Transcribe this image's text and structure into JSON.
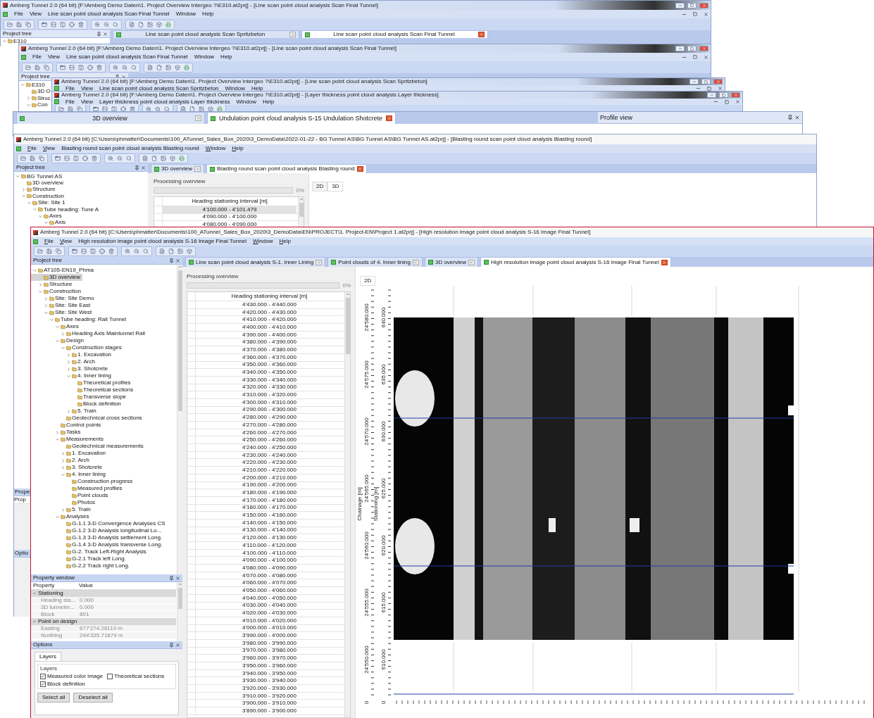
{
  "windows": [
    {
      "kind": "compact",
      "title": "Amberg Tunnel 2.0 (64 bit) [F:\\Amberg Demo Daten\\1. Project Overview Intergeo ?\\E310.at2prj] - [Line scan point cloud analysis Scan Final Tunnel]",
      "menu": [
        {
          "label": "File"
        },
        {
          "label": "View"
        },
        {
          "label": "Line scan point cloud analysis Scan Final Tunnel"
        },
        {
          "label": "Window"
        },
        {
          "label": "Help"
        }
      ],
      "tree_title": "Project tree",
      "tree": [
        {
          "label": "E310",
          "expanded": true,
          "selected": false
        }
      ],
      "tabs": [
        {
          "label": "Line scan point cloud analysis Scan Spritzbeton",
          "selected": false
        },
        {
          "label": "Line scan point cloud analysis Scan Final Tunnel",
          "selected": true
        }
      ]
    },
    {
      "kind": "compact",
      "title": "Amberg Tunnel 2.0 (64 bit) [F:\\Amberg Demo Daten\\1. Project Overview Intergeo ?\\E310.at2prj] - [Line scan point cloud analysis Scan Final Tunnel]",
      "menu": [
        {
          "label": "File"
        },
        {
          "label": "View"
        },
        {
          "label": "Line scan point cloud analysis Scan Final Tunnel"
        },
        {
          "label": "Window"
        },
        {
          "label": "Help"
        }
      ],
      "tree_title": "Project tree",
      "tree": [
        {
          "label": "E310",
          "expanded": true,
          "selected": false,
          "children": [
            {
              "label": "3D O",
              "selected": false
            },
            {
              "label": "Struc",
              "expanded": false,
              "selected": false
            },
            {
              "label": "Con",
              "expanded": true,
              "selected": false
            }
          ]
        }
      ]
    },
    {
      "kind": "compact",
      "title": "Amberg Tunnel 2.0 (64 bit) [F:\\Amberg Demo Daten\\1. Project Overview Intergeo ?\\E310.at2prj] - [Line scan point cloud analysis Scan Spritzbeton]",
      "menu": [
        {
          "label": "File"
        },
        {
          "label": "View"
        },
        {
          "label": "Line scan point cloud analysis Scan Spritzbeton"
        },
        {
          "label": "Window"
        },
        {
          "label": "Help"
        }
      ]
    },
    {
      "kind": "compact",
      "title": "Amberg Tunnel 2.0 (64 bit) [F:\\Amberg Demo Daten\\1. Project Overview Intergeo ?\\E310.at2prj] - [Layer thickness point cloud analysis Layer thickness]",
      "menu": [
        {
          "label": "File"
        },
        {
          "label": "View"
        },
        {
          "label": "Layer thickness point cloud analysis Layer thickness"
        },
        {
          "label": "Window"
        },
        {
          "label": "Help"
        }
      ]
    },
    {
      "kind": "fragment",
      "tabs": [
        {
          "label": "3D overview",
          "selected": false
        },
        {
          "label": "Undulation point cloud analysis S-15 Undulation Shotcrete",
          "selected": true
        }
      ],
      "panel_title": "Profile view"
    },
    {
      "kind": "blast",
      "title": "Amberg Tunnel 2.0 (64 bit) [C:\\Users\\phmatter\\Documents\\100_ATunnel_Sales_Box_2020\\3_DemoData\\2022-01-22 - BG Tunnel AS\\BG Tunnel AS\\BG Tunnel AS.at2prj] - [Blasting round scan point cloud analysis Blasting round]",
      "menu": [
        {
          "label": "File",
          "kind": "command"
        },
        {
          "label": "View",
          "kind": "command"
        },
        {
          "label": "Blasting round scan point cloud analysis Blasting round",
          "kind": "document"
        },
        {
          "label": "Window",
          "kind": "command"
        },
        {
          "label": "Help",
          "kind": "command"
        }
      ],
      "tree_title": "Project tree",
      "tree": [
        {
          "label": "BG Tunnel AS",
          "expanded": true,
          "selected": false,
          "children": [
            {
              "label": "3D overview",
              "selected": false
            },
            {
              "label": "Structure",
              "expanded": false,
              "selected": false
            },
            {
              "label": "Construction",
              "expanded": true,
              "selected": false,
              "children": [
                {
                  "label": "Site: Site 1",
                  "expanded": true,
                  "selected": false,
                  "children": [
                    {
                      "label": "Tube heading: Tune A",
                      "expanded": true,
                      "selected": false,
                      "children": [
                        {
                          "label": "Axes",
                          "expanded": true,
                          "selected": false,
                          "children": [
                            {
                              "label": "Axis",
                              "expanded": true,
                              "selected": false
                            }
                          ]
                        }
                      ]
                    }
                  ]
                }
              ]
            }
          ]
        }
      ],
      "property_stub": "Prope",
      "property_column_stub": "Prop",
      "options_stub": "Optio",
      "tabs": [
        {
          "label": "3D overview",
          "selected": false
        },
        {
          "label": "Blasting round scan point cloud analysis Blasting round",
          "selected": true
        }
      ],
      "progress": {
        "label": "Processing overview",
        "level": 0,
        "reading": "0%"
      },
      "table_header": "Heading stationing interval [m]",
      "rows": [
        {
          "range": "4'100.000 - 4'101.479",
          "selected": true
        },
        {
          "range": "4'090.000 - 4'100.000",
          "selected": false
        },
        {
          "range": "4'080.000 - 4'090.000",
          "selected": false
        }
      ],
      "view_tabs": [
        {
          "label": "2D",
          "selected": false
        },
        {
          "label": "3D",
          "selected": true
        }
      ]
    },
    {
      "kind": "main",
      "title": "Amberg Tunnel 2.0 (64 bit) [C:\\Users\\phmatter\\Documents\\100_ATunnel_Sales_Box_2020\\3_DemoData\\EN\\PROJECT\\1. Project-EN\\Project 1.at2prj] - [High resolution image point cloud analysis S-16 Image Final Tunnel]",
      "menu": [
        {
          "label": "File",
          "kind": "command"
        },
        {
          "label": "View",
          "kind": "command"
        },
        {
          "label": "High resolution image point cloud analysis S-16 Image Final Tunnel",
          "kind": "document"
        },
        {
          "label": "Window",
          "kind": "command"
        },
        {
          "label": "Help",
          "kind": "command"
        }
      ],
      "tree_title": "Project tree",
      "tree": [
        {
          "label": "AT105-EN19_Phma",
          "expanded": true,
          "selected": false,
          "children": [
            {
              "label": "3D overview",
              "selected": true
            },
            {
              "label": "Structure",
              "expanded": false,
              "selected": false
            },
            {
              "label": "Construction",
              "expanded": true,
              "selected": false,
              "children": [
                {
                  "label": "Site: Site Demo",
                  "expanded": false,
                  "selected": false
                },
                {
                  "label": "Site: Site East",
                  "expanded": false,
                  "selected": false
                },
                {
                  "label": "Site: Site West",
                  "expanded": true,
                  "selected": false,
                  "children": [
                    {
                      "label": "Tube heading: Rail Tunnel",
                      "expanded": true,
                      "selected": false,
                      "children": [
                        {
                          "label": "Axes",
                          "expanded": true,
                          "selected": false,
                          "children": [
                            {
                              "label": "Heading Axis Maintunnel Rail",
                              "expanded": false,
                              "selected": false
                            }
                          ]
                        },
                        {
                          "label": "Design",
                          "expanded": true,
                          "selected": false,
                          "children": [
                            {
                              "label": "Construction stages",
                              "expanded": true,
                              "selected": false,
                              "children": [
                                {
                                  "label": "1. Excavation",
                                  "expanded": false,
                                  "selected": false
                                },
                                {
                                  "label": "2. Arch",
                                  "expanded": false,
                                  "selected": false
                                },
                                {
                                  "label": "3. Shotcrete",
                                  "expanded": false,
                                  "selected": false
                                },
                                {
                                  "label": "4. Inner lining",
                                  "expanded": true,
                                  "selected": false,
                                  "children": [
                                    {
                                      "label": "Theoretical profiles",
                                      "selected": false
                                    },
                                    {
                                      "label": "Theoretical sections",
                                      "selected": false
                                    },
                                    {
                                      "label": "Transverse slope",
                                      "selected": false
                                    },
                                    {
                                      "label": "Block definition",
                                      "selected": false
                                    }
                                  ]
                                },
                                {
                                  "label": "5. Train",
                                  "expanded": false,
                                  "selected": false
                                }
                              ]
                            },
                            {
                              "label": "Geotechnical cross sections",
                              "selected": false
                            }
                          ]
                        },
                        {
                          "label": "Control points",
                          "selected": false
                        },
                        {
                          "label": "Tasks",
                          "expanded": false,
                          "selected": false
                        },
                        {
                          "label": "Measurements",
                          "expanded": true,
                          "selected": false,
                          "children": [
                            {
                              "label": "Geotechnical measurements",
                              "selected": false
                            },
                            {
                              "label": "1. Excavation",
                              "expanded": false,
                              "selected": false
                            },
                            {
                              "label": "2. Arch",
                              "expanded": false,
                              "selected": false
                            },
                            {
                              "label": "3. Shotcrete",
                              "expanded": false,
                              "selected": false
                            },
                            {
                              "label": "4. Inner lining",
                              "expanded": true,
                              "selected": false,
                              "children": [
                                {
                                  "label": "Construction progress",
                                  "selected": false
                                },
                                {
                                  "label": "Measured profiles",
                                  "selected": false
                                },
                                {
                                  "label": "Point clouds",
                                  "selected": false
                                },
                                {
                                  "label": "Photos",
                                  "selected": false
                                }
                              ]
                            },
                            {
                              "label": "5. Train",
                              "expanded": false,
                              "selected": false
                            }
                          ]
                        },
                        {
                          "label": "Analyses",
                          "expanded": true,
                          "selected": false,
                          "children": [
                            {
                              "label": "G-1.1 3-D Convergence Analyses CS",
                              "selected": false
                            },
                            {
                              "label": "G-1.2 3-D Analysis longitudinal Lo...",
                              "selected": false
                            },
                            {
                              "label": "G-1.3 3-D Analysis settlement Long.",
                              "selected": false
                            },
                            {
                              "label": "G-1.4 3-D Analysis transverse Long.",
                              "selected": false
                            },
                            {
                              "label": "G-2. Track Left-Right Analysis",
                              "selected": false
                            },
                            {
                              "label": "G-2.1 Track left Long.",
                              "selected": false
                            },
                            {
                              "label": "G-2.2 Track right Long.",
                              "selected": false
                            }
                          ]
                        }
                      ]
                    }
                  ]
                }
              ]
            }
          ]
        }
      ],
      "property_window": {
        "title": "Property window",
        "columns": [
          "Property",
          "Value"
        ],
        "groups": [
          {
            "label": "Stationing",
            "expanded": true,
            "rows": [
              {
                "name": "Heading sta...",
                "value": "0.000"
              },
              {
                "name": "3D tunnelm...",
                "value": "0.000"
              },
              {
                "name": "Block",
                "value": "801"
              }
            ]
          },
          {
            "label": "Point on design",
            "expanded": true,
            "rows": [
              {
                "name": "Easting",
                "value": "677'274.28119 m"
              },
              {
                "name": "Northing",
                "value": "244'335.71879 m"
              }
            ]
          }
        ]
      },
      "options": {
        "title": "Options",
        "tab": "Layers",
        "group": "Layers",
        "checkboxes": [
          {
            "label": "Measured color image",
            "checked": true
          },
          {
            "label": "Theoretical sections",
            "checked": false
          },
          {
            "label": "Block definition",
            "checked": true
          }
        ],
        "buttons": [
          "Select all",
          "Deselect all"
        ]
      },
      "tabs": [
        {
          "label": "Line scan point cloud analysis S-1. Inner Lining",
          "selected": false
        },
        {
          "label": "Point clouds of 4. Inner lining",
          "selected": false
        },
        {
          "label": "3D overview",
          "selected": false
        },
        {
          "label": "High resolution image point cloud analysis S-16 Image Final Tunnel",
          "selected": true
        }
      ],
      "progress": {
        "label": "Processing overview",
        "level": 0,
        "reading": "0%"
      },
      "table_header": "Heading stationing interval [m]",
      "rows": [
        "4'430.000 - 4'440.000",
        "4'420.000 - 4'430.000",
        "4'410.000 - 4'420.000",
        "4'400.000 - 4'410.000",
        "4'390.000 - 4'400.000",
        "4'380.000 - 4'390.000",
        "4'370.000 - 4'380.000",
        "4'360.000 - 4'370.000",
        "4'350.000 - 4'360.000",
        "4'340.000 - 4'350.000",
        "4'330.000 - 4'340.000",
        "4'320.000 - 4'330.000",
        "4'310.000 - 4'320.000",
        "4'300.000 - 4'310.000",
        "4'290.000 - 4'300.000",
        "4'280.000 - 4'290.000",
        "4'270.000 - 4'280.000",
        "4'260.000 - 4'270.000",
        "4'250.000 - 4'260.000",
        "4'240.000 - 4'250.000",
        "4'230.000 - 4'240.000",
        "4'220.000 - 4'230.000",
        "4'210.000 - 4'220.000",
        "4'200.000 - 4'210.000",
        "4'190.000 - 4'200.000",
        "4'180.000 - 4'190.000",
        "4'170.000 - 4'180.000",
        "4'160.000 - 4'170.000",
        "4'150.000 - 4'160.000",
        "4'140.000 - 4'150.000",
        "4'130.000 - 4'140.000",
        "4'120.000 - 4'130.000",
        "4'110.000 - 4'120.000",
        "4'100.000 - 4'110.000",
        "4'090.000 - 4'100.000",
        "4'080.000 - 4'090.000",
        "4'070.000 - 4'080.000",
        "4'060.000 - 4'070.000",
        "4'050.000 - 4'060.000",
        "4'040.000 - 4'050.000",
        "4'030.000 - 4'040.000",
        "4'020.000 - 4'030.000",
        "4'010.000 - 4'020.000",
        "4'000.000 - 4'010.000",
        "3'990.000 - 4'000.000",
        "3'980.000 - 3'990.000",
        "3'970.000 - 3'980.000",
        "3'960.000 - 3'970.000",
        "3'950.000 - 3'960.000",
        "3'940.000 - 3'950.000",
        "3'930.000 - 3'940.000",
        "3'920.000 - 3'930.000",
        "3'910.000 - 3'920.000",
        "3'900.000 - 3'910.000",
        "3'890.000 - 3'900.000"
      ],
      "view": {
        "tab": "2D",
        "chainage_title": "Chainage [m]",
        "stationing_title": "Stationing [m]",
        "chainage_ticks": [
          "24'580.000",
          "24'575.000",
          "24'570.000",
          "24'565.000",
          "24'560.000",
          "24'555.000",
          "24'550.000"
        ],
        "stationing_ticks": [
          "640.000",
          "635.000",
          "630.000",
          "625.000",
          "620.000",
          "615.000",
          "610.000"
        ],
        "origin_labels": [
          "0",
          "0"
        ]
      }
    }
  ]
}
